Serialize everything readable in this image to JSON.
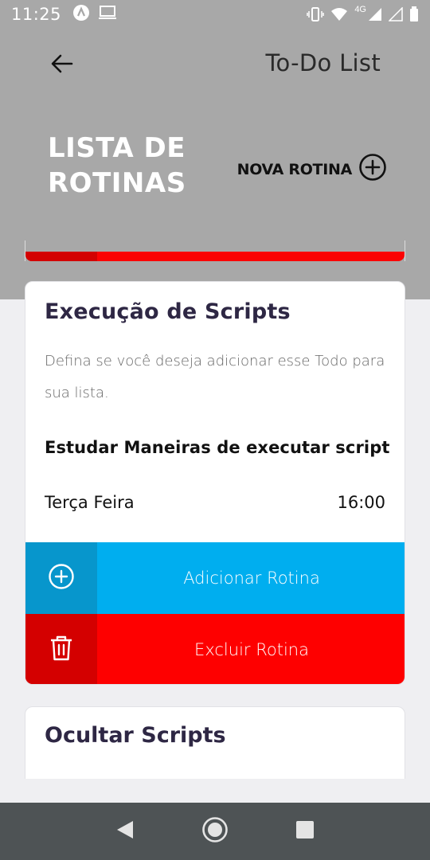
{
  "status_bar": {
    "time": "11:25",
    "network": "4G",
    "icons": [
      "app-notification-icon",
      "screen-cast-icon",
      "vibrate-icon",
      "wifi-icon",
      "signal-icon",
      "signal-empty-icon",
      "battery-icon"
    ]
  },
  "header": {
    "app_title": "To-Do List",
    "page_title": "LISTA DE ROTINAS",
    "new_routine_label": "NOVA ROTINA",
    "back_icon": "arrow-left-icon",
    "add_icon": "plus-circle-icon"
  },
  "card": {
    "title": "Execução de Scripts",
    "description": "Defina se você deseja adicionar esse Todo para sua lista.",
    "task_name": "Estudar Maneiras de executar script",
    "day": "Terça Feira",
    "time": "16:00",
    "add_label": "Adicionar Rotina",
    "delete_label": "Excluir Rotina"
  },
  "card2": {
    "title": "Ocultar Scripts"
  },
  "colors": {
    "header_bg": "#a8a8a8",
    "add_blue": "#00aeef",
    "add_blue_dark": "#0796cc",
    "delete_red": "#fe0000",
    "delete_red_dark": "#d40000",
    "title_color": "#2e2744"
  },
  "nav_bar": {
    "icons": [
      "back-triangle-icon",
      "home-circle-icon",
      "recents-square-icon"
    ]
  }
}
